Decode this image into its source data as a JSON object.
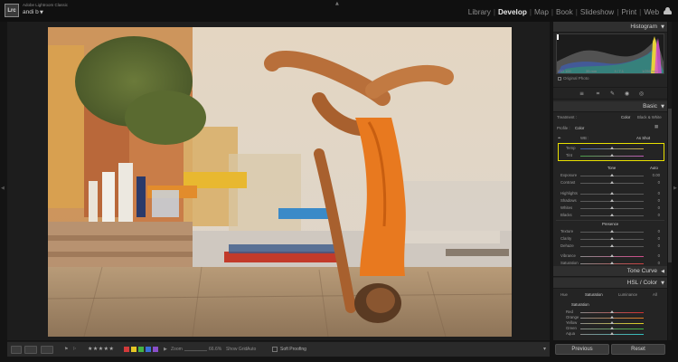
{
  "app": {
    "name": "Adobe Lightroom Classic",
    "user": "andi b",
    "modules": [
      "Library",
      "Develop",
      "Map",
      "Book",
      "Slideshow",
      "Print",
      "Web"
    ],
    "active_module": "Develop"
  },
  "histogram": {
    "title": "Histogram",
    "info": [
      "ISO 100",
      "35 mm",
      "f / 7.1",
      "1/250 sec"
    ],
    "original_photo": "Original Photo"
  },
  "basic": {
    "title": "Basic",
    "treatment_label": "Treatment :",
    "treatment_color": "Color",
    "treatment_bw": "Black & White",
    "profile_label": "Profile :",
    "profile_value": "Color",
    "wb_label": "WB :",
    "wb_value": "As Shot",
    "sliders": [
      {
        "label": "Temp",
        "level": 0.5
      },
      {
        "label": "Tint",
        "level": 0.5
      }
    ],
    "tone_label": "Tone",
    "tone_auto": "Auto",
    "tone_sliders": [
      {
        "label": "Exposure",
        "value": "0.00",
        "level": 0.5
      },
      {
        "label": "Contrast",
        "value": "0",
        "level": 0.5
      },
      {
        "label": "Highlights",
        "value": "0",
        "level": 0.5
      },
      {
        "label": "Shadows",
        "value": "0",
        "level": 0.5
      },
      {
        "label": "Whites",
        "value": "0",
        "level": 0.5
      },
      {
        "label": "Blacks",
        "value": "0",
        "level": 0.5
      }
    ],
    "presence_label": "Presence",
    "presence_sliders": [
      {
        "label": "Texture",
        "value": "0",
        "level": 0.5
      },
      {
        "label": "Clarity",
        "value": "0",
        "level": 0.5
      },
      {
        "label": "Dehaze",
        "value": "0",
        "level": 0.5
      },
      {
        "label": "Vibrance",
        "value": "0",
        "level": 0.5
      },
      {
        "label": "Saturation",
        "value": "0",
        "level": 0.5
      }
    ]
  },
  "tone_curve": {
    "title": "Tone Curve"
  },
  "hsl": {
    "title": "HSL / Color",
    "tabs": [
      "Hue",
      "Saturation",
      "Luminance",
      "All"
    ],
    "active_tab": "Saturation",
    "section": "Saturation",
    "colors": [
      "Red",
      "Orange",
      "Yellow",
      "Green",
      "Aqua"
    ]
  },
  "toolbar": {
    "stars": "★★★★★",
    "zoom_label": "Zoom",
    "zoom_value": "66.6%",
    "show_grid_label": "Show Grid:",
    "show_grid_value": "Auto",
    "soft_proofing": "Soft Proofing",
    "label_colors": [
      "#d23a3a",
      "#e6c624",
      "#44b344",
      "#3b6fd6",
      "#8a4fc9"
    ]
  },
  "buttons": {
    "previous": "Previous",
    "reset": "Reset"
  }
}
